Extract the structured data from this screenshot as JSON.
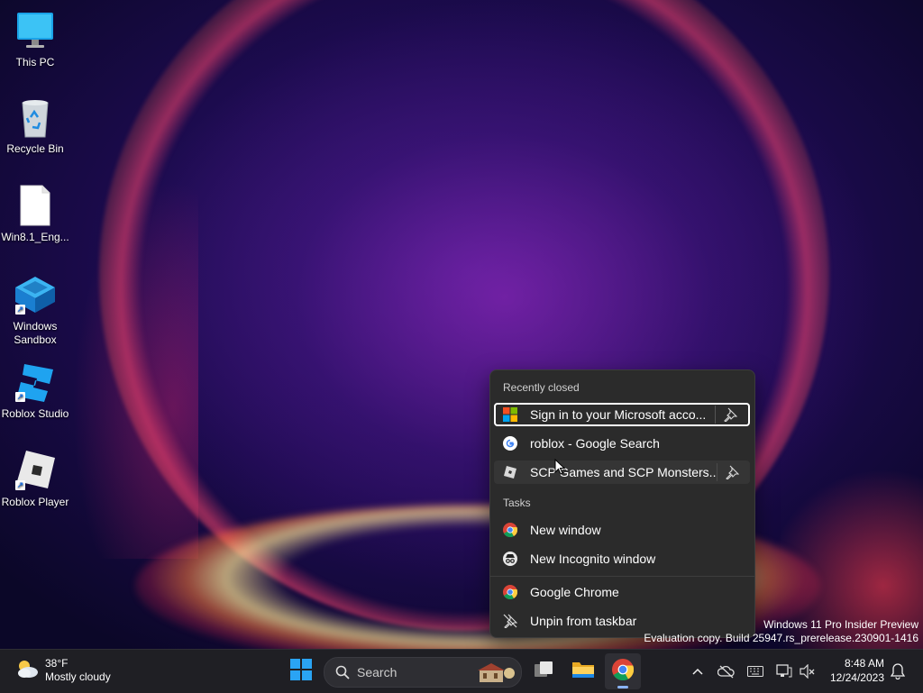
{
  "desktop": {
    "icons": [
      {
        "label": "This PC"
      },
      {
        "label": "Recycle Bin"
      },
      {
        "label": "Win8.1_Eng..."
      },
      {
        "label": "Windows Sandbox"
      },
      {
        "label": "Roblox Studio"
      },
      {
        "label": "Roblox Player"
      }
    ]
  },
  "jumplist": {
    "recent_header": "Recently closed",
    "recent": [
      {
        "label": "Sign in to your Microsoft acco...",
        "icon": "microsoft-logo-icon",
        "pinnable": true
      },
      {
        "label": "roblox - Google Search",
        "icon": "google-icon",
        "pinnable": false
      },
      {
        "label": "SCP Games and SCP Monsters...",
        "icon": "roblox-icon",
        "pinnable": true
      }
    ],
    "tasks_header": "Tasks",
    "tasks": [
      {
        "label": "New window",
        "icon": "chrome-icon"
      },
      {
        "label": "New Incognito window",
        "icon": "incognito-icon"
      }
    ],
    "app": [
      {
        "label": "Google Chrome",
        "icon": "chrome-icon"
      },
      {
        "label": "Unpin from taskbar",
        "icon": "unpin-icon"
      }
    ]
  },
  "watermark": {
    "line1": "Windows 11 Pro Insider Preview",
    "line2": "Evaluation copy. Build 25947.rs_prerelease.230901-1416"
  },
  "taskbar": {
    "weather": {
      "temp": "38°F",
      "condition": "Mostly cloudy"
    },
    "search_placeholder": "Search",
    "clock": {
      "time": "8:48 AM",
      "date": "12/24/2023"
    }
  },
  "colors": {
    "jumplist_bg": "#2b2b2b",
    "taskbar_bg": "#1f1f24",
    "accent_blue": "#1d8cf0"
  }
}
